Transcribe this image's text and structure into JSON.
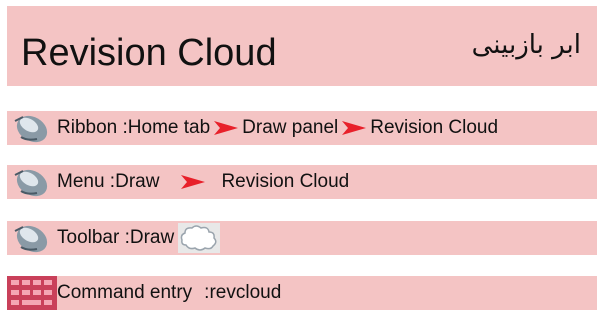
{
  "header": {
    "title_en": "Revision Cloud",
    "title_fa": "ابر بازبینی"
  },
  "rows": {
    "ribbon": {
      "icon": "mouse-icon",
      "prefix": "Ribbon :",
      "tab": "Home tab",
      "panel": "Draw panel",
      "command": "Revision Cloud"
    },
    "menu": {
      "icon": "mouse-icon",
      "prefix": "Menu :",
      "menu_name": "Draw",
      "command": "Revision Cloud"
    },
    "toolbar": {
      "icon": "mouse-icon",
      "prefix": "Toolbar :",
      "toolbar_name": "Draw",
      "tool_icon": "revision-cloud-icon"
    },
    "command": {
      "icon": "keyboard-icon",
      "label": "Command entry",
      "value": ":revcloud"
    }
  },
  "colors": {
    "row_background": "#f4c4c4",
    "arrow": "#e8202a",
    "text": "#111111"
  }
}
